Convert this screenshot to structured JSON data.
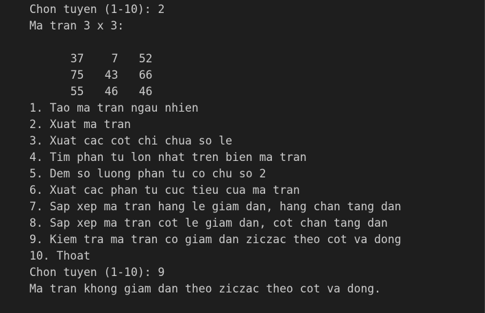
{
  "terminal": {
    "prompt_line_1": "Chon tuyen (1-10): 2",
    "matrix_header": "Ma tran 3 x 3:",
    "matrix": [
      [
        "37",
        "7",
        "52"
      ],
      [
        "75",
        "43",
        "66"
      ],
      [
        "55",
        "46",
        "46"
      ]
    ],
    "menu": [
      "1. Tao ma tran ngau nhien",
      "2. Xuat ma tran",
      "3. Xuat cac cot chi chua so le",
      "4. Tim phan tu lon nhat tren bien ma tran",
      "5. Dem so luong phan tu co chu so 2",
      "6. Xuat cac phan tu cuc tieu cua ma tran",
      "7. Sap xep ma tran hang le giam dan, hang chan tang dan",
      "8. Sap xep ma tran cot le giam dan, cot chan tang dan",
      "9. Kiem tra ma tran co giam dan ziczac theo cot va dong",
      "10. Thoat"
    ],
    "prompt_line_2": "Chon tuyen (1-10): 9",
    "result_line": "Ma tran khong giam dan theo ziczac theo cot va dong."
  }
}
